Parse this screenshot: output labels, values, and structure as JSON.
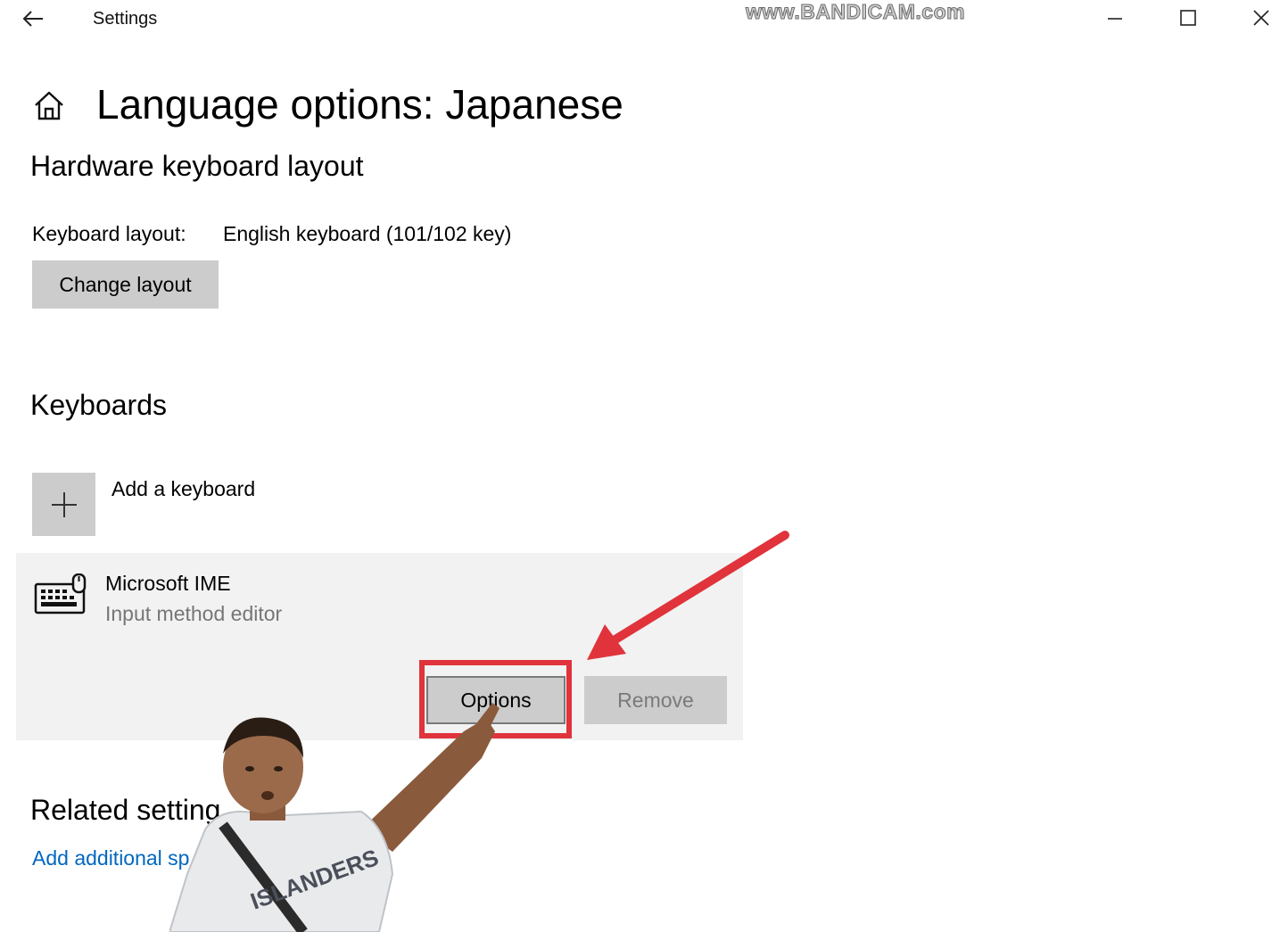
{
  "titlebar": {
    "app_title": "Settings",
    "watermark": "www.BANDICAM.com",
    "back_icon": "arrow-left-icon",
    "minimize_icon": "minimize-icon",
    "maximize_icon": "maximize-icon",
    "close_icon": "close-icon"
  },
  "header": {
    "home_icon": "home-icon",
    "title": "Language options: Japanese"
  },
  "hardware_keyboard": {
    "section_title": "Hardware keyboard layout",
    "layout_label": "Keyboard layout:",
    "layout_value": "English keyboard (101/102 key)",
    "change_button": "Change layout"
  },
  "keyboards": {
    "section_title": "Keyboards",
    "add_label": "Add a keyboard",
    "add_icon": "plus-icon",
    "items": [
      {
        "icon": "keyboard-icon",
        "name": "Microsoft IME",
        "description": "Input method editor",
        "options_button": "Options",
        "remove_button": "Remove"
      }
    ]
  },
  "related": {
    "section_title": "Related setting",
    "link": "Add additional sp"
  },
  "colors": {
    "accent_link": "#0067c0",
    "highlight": "#e0333b",
    "button_gray": "#cccccc",
    "panel_gray": "#f2f2f2"
  }
}
